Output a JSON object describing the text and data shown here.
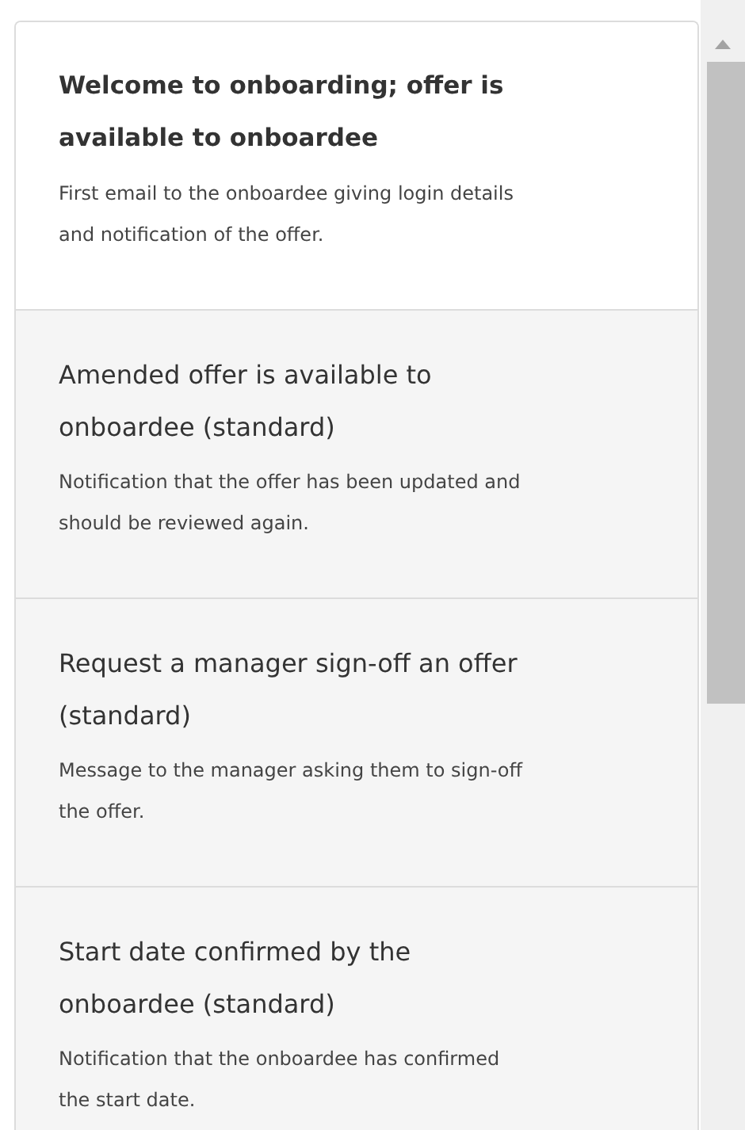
{
  "templates": [
    {
      "title": "Welcome to onboarding; offer is available to onboardee",
      "description": "First email to the onboardee giving login details and notification of the offer.",
      "selected": true
    },
    {
      "title": "Amended offer is available to onboardee (standard)",
      "description": "Notification that the offer has been updated and should be reviewed again.",
      "selected": false
    },
    {
      "title": "Request a manager sign-off an offer (standard)",
      "description": "Message to the manager asking them to sign-off the offer.",
      "selected": false
    },
    {
      "title": "Start date confirmed by the onboardee (standard)",
      "description": "Notification that the onboardee has confirmed the start date.",
      "selected": false
    }
  ]
}
